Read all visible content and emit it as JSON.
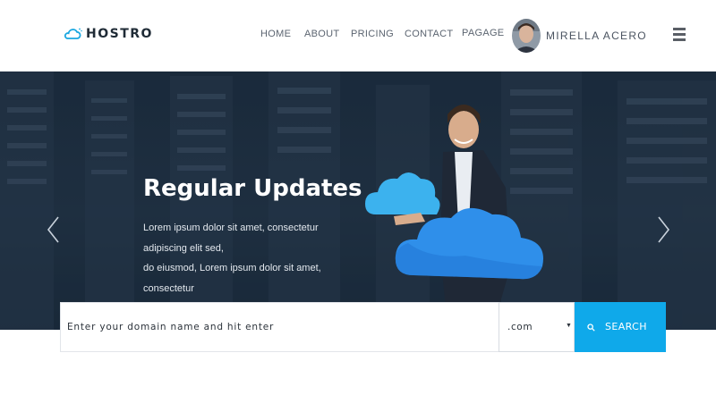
{
  "brand": {
    "name": "HOSTRO",
    "logo_icon": "cloud-icon",
    "accent": "#1aa7e0"
  },
  "nav": {
    "items": [
      {
        "label": "HOME"
      },
      {
        "label": "ABOUT"
      },
      {
        "label": "PRICING"
      },
      {
        "label": "CONTACT"
      },
      {
        "label": "PAGAGE"
      }
    ]
  },
  "user": {
    "name": "MIRELLA ACERO",
    "avatar_icon": "user-avatar"
  },
  "menu": {
    "icon": "hamburger-icon"
  },
  "hero": {
    "title": "Regular Updates",
    "description_lines": [
      "Lorem ipsum dolor sit amet, consectetur",
      "adipiscing elit sed,",
      "do eiusmod, Lorem ipsum dolor sit amet,",
      "consectetur"
    ],
    "prev_icon": "chevron-left-icon",
    "next_icon": "chevron-right-icon"
  },
  "search": {
    "placeholder": "Enter your domain name and hit enter",
    "tld_selected": ".com",
    "button_label": "SEARCH",
    "button_color": "#0fa9ea",
    "icon": "search-icon"
  }
}
